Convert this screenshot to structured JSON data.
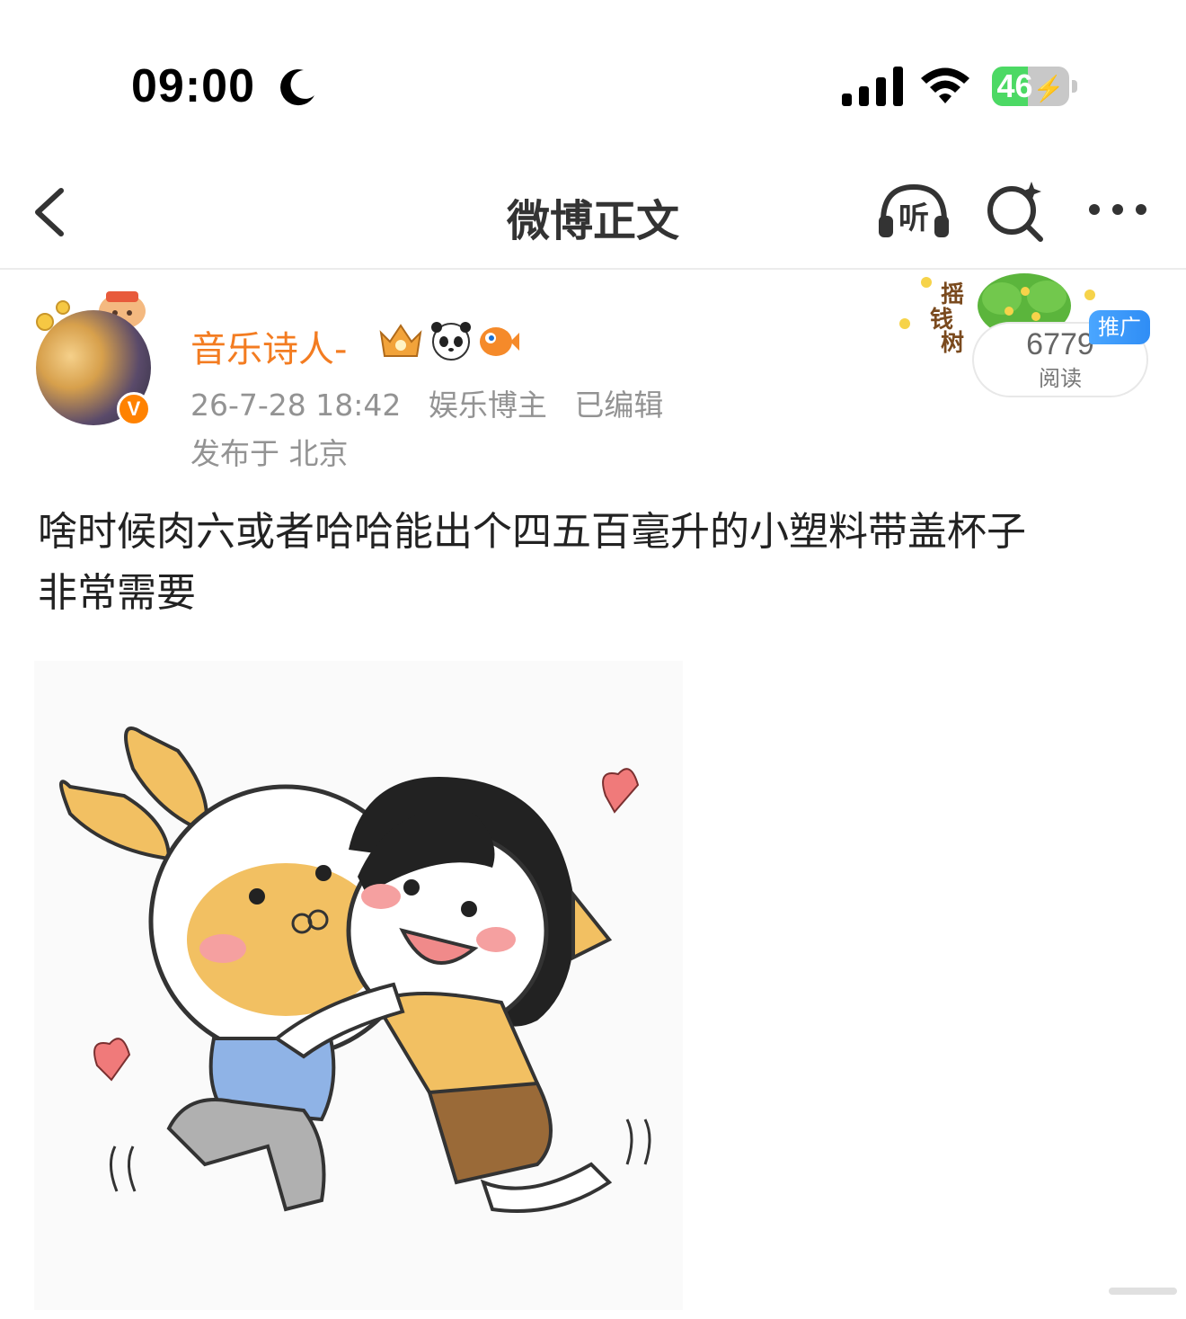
{
  "status_bar": {
    "time": "09:00",
    "battery_level": "46",
    "battery_fraction": 0.46,
    "icons": [
      "moon-icon",
      "signal-icon",
      "wifi-icon",
      "battery-charging-icon"
    ]
  },
  "nav": {
    "title": "微博正文",
    "listen_label": "听",
    "icons": [
      "back-icon",
      "listen-headphones-icon",
      "search-sparkle-icon",
      "more-icon"
    ]
  },
  "post": {
    "author": {
      "name": "音乐诗人-",
      "verified_mark": "V",
      "badges": [
        "crown-badge-icon",
        "panda-badge-icon",
        "fish-badge-icon"
      ]
    },
    "meta": {
      "date": "26-7-28 18:42",
      "role": "娱乐博主",
      "edited": "已编辑"
    },
    "location": "发布于 北京",
    "text_line1": "啥时候肉六或者哈哈能出个四五百毫升的小塑料带盖杯子",
    "text_line2": "非常需要"
  },
  "promo": {
    "tree_text": [
      "摇",
      "钱",
      "树"
    ],
    "read_count": "6779",
    "read_label": "阅读",
    "tag": "推广"
  },
  "colors": {
    "accent_orange": "#f37c21",
    "battery_green": "#4cd964",
    "promo_blue": "#2f8df5",
    "meta_gray": "#939393"
  }
}
